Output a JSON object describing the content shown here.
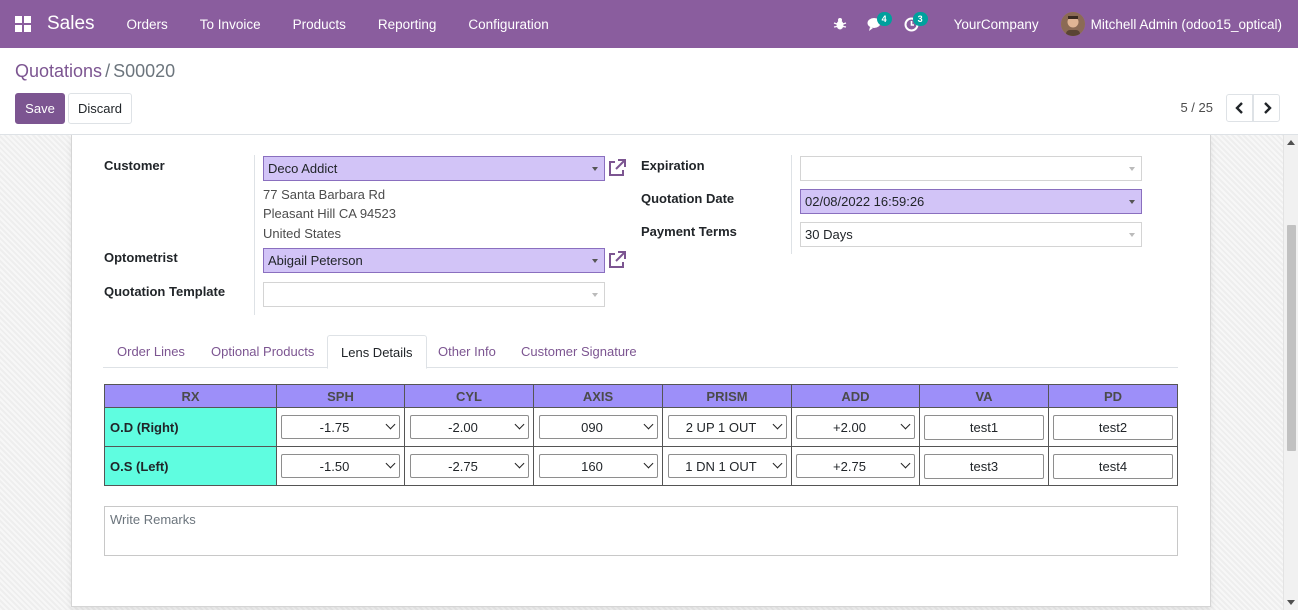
{
  "navbar": {
    "app_name": "Sales",
    "menu": [
      "Orders",
      "To Invoice",
      "Products",
      "Reporting",
      "Configuration"
    ],
    "messages_badge": "4",
    "activities_badge": "3",
    "company": "YourCompany",
    "user": "Mitchell Admin (odoo15_optical)"
  },
  "breadcrumb": {
    "parent": "Quotations",
    "separator": "/",
    "current": "S00020"
  },
  "buttons": {
    "save": "Save",
    "discard": "Discard"
  },
  "pager": {
    "value": "5 / 25"
  },
  "form": {
    "customer_label": "Customer",
    "customer_value": "Deco Addict",
    "address": [
      "77 Santa Barbara Rd",
      "Pleasant Hill CA 94523",
      "United States"
    ],
    "optometrist_label": "Optometrist",
    "optometrist_value": "Abigail Peterson",
    "template_label": "Quotation Template",
    "template_value": "",
    "expiration_label": "Expiration",
    "expiration_value": "",
    "quotation_date_label": "Quotation Date",
    "quotation_date_value": "02/08/2022 16:59:26",
    "payment_terms_label": "Payment Terms",
    "payment_terms_value": "30 Days"
  },
  "tabs": [
    "Order Lines",
    "Optional Products",
    "Lens Details",
    "Other Info",
    "Customer Signature"
  ],
  "active_tab": "Lens Details",
  "lens_table": {
    "headers": [
      "RX",
      "SPH",
      "CYL",
      "AXIS",
      "PRISM",
      "ADD",
      "VA",
      "PD"
    ],
    "rows": [
      {
        "rx": "O.D (Right)",
        "sph": "-1.75",
        "cyl": "-2.00",
        "axis": "090",
        "prism": "2 UP 1 OUT",
        "add": "+2.00",
        "va": "test1",
        "pd": "test2"
      },
      {
        "rx": "O.S (Left)",
        "sph": "-1.50",
        "cyl": "-2.75",
        "axis": "160",
        "prism": "1 DN 1 OUT",
        "add": "+2.75",
        "va": "test3",
        "pd": "test4"
      }
    ]
  },
  "remarks": {
    "placeholder": "Write Remarks"
  },
  "colors": {
    "brand": "#8a5d9e",
    "required_field": "#d2c4f7",
    "table_header": "#9d8ff9",
    "rx_cell": "#5ffde0",
    "badge": "#00a09d"
  }
}
